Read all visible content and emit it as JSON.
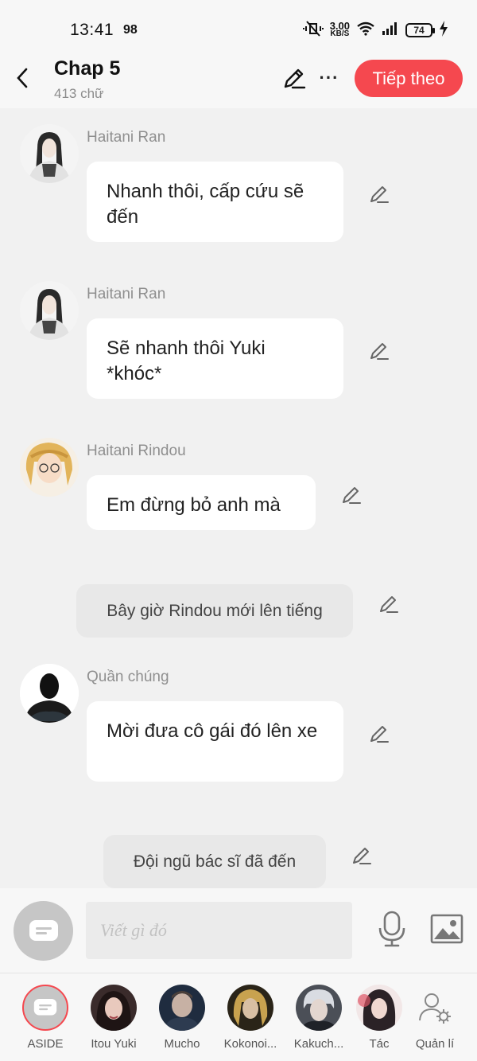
{
  "status": {
    "time": "13:41",
    "count": "98",
    "speed_value": "3.00",
    "speed_unit": "KB/S",
    "battery": "74"
  },
  "header": {
    "title": "Chap 5",
    "subtitle": "413 chữ",
    "next_label": "Tiếp theo"
  },
  "messages": [
    {
      "type": "character",
      "name": "Haitani Ran",
      "text": "Nhanh thôi, cấp cứu sẽ đến"
    },
    {
      "type": "character",
      "name": "Haitani Ran",
      "text": "Sẽ nhanh thôi Yuki *khóc*"
    },
    {
      "type": "character",
      "name": "Haitani Rindou",
      "text": "Em đừng bỏ anh mà"
    },
    {
      "type": "narration",
      "text": "Bây giờ Rindou mới lên tiếng"
    },
    {
      "type": "character",
      "name": "Quần chúng",
      "text": "Mời đưa cô gái đó lên xe"
    },
    {
      "type": "narration",
      "text": "Đội ngũ bác sĩ đã đến"
    }
  ],
  "composer": {
    "placeholder": "Viết gì đó"
  },
  "characters": [
    {
      "label": "ASIDE"
    },
    {
      "label": "Itou Yuki"
    },
    {
      "label": "Mucho"
    },
    {
      "label": "Kokonoi..."
    },
    {
      "label": "Kakuch..."
    },
    {
      "label": "Tác"
    },
    {
      "label": "Quản lí"
    }
  ],
  "colors": {
    "accent": "#f5484f",
    "background": "#f1f1f1",
    "bubble": "#ffffff",
    "narration": "#e8e8e8"
  }
}
